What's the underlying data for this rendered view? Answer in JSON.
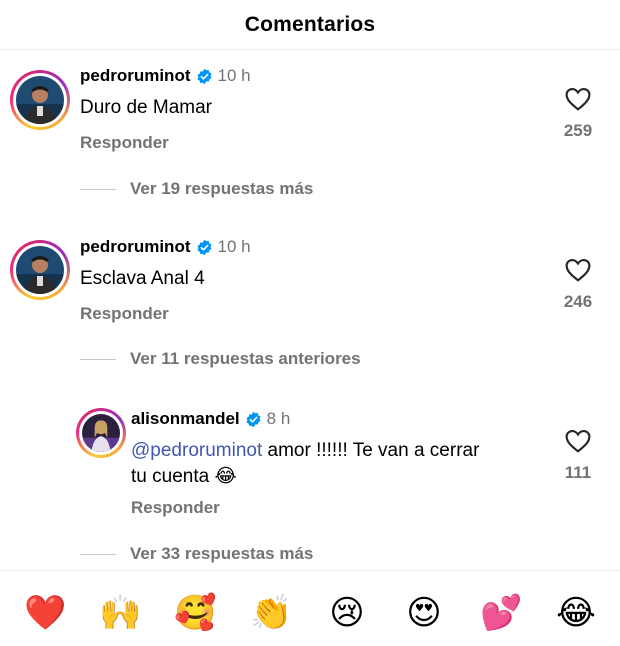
{
  "header": {
    "title": "Comentarios"
  },
  "comments": [
    {
      "username": "pedroruminot",
      "time": "10 h",
      "text": "Duro de Mamar",
      "reply_label": "Responder",
      "likes": "259",
      "thread_label": "Ver 19 respuestas más"
    },
    {
      "username": "pedroruminot",
      "time": "10 h",
      "text": "Esclava Anal 4",
      "reply_label": "Responder",
      "likes": "246",
      "thread_label": "Ver 11 respuestas anteriores"
    },
    {
      "username": "alisonmandel",
      "time": "8 h",
      "mention": "@pedroruminot",
      "text_line1": " amor !!!!!! Te van a cerrar",
      "text_line2": "tu cuenta 😂",
      "reply_label": "Responder",
      "likes": "111",
      "thread_label": "Ver 33 respuestas más"
    }
  ],
  "reactions": [
    "❤️",
    "🙌",
    "🥰",
    "👏",
    "😢",
    "😍",
    "💕",
    "😂"
  ],
  "colors": {
    "verified": "#0095f6",
    "secondary_text": "#737373",
    "mention": "#4257b2"
  },
  "icons": {
    "verified": "verified-badge-icon",
    "like": "heart-outline-icon"
  }
}
